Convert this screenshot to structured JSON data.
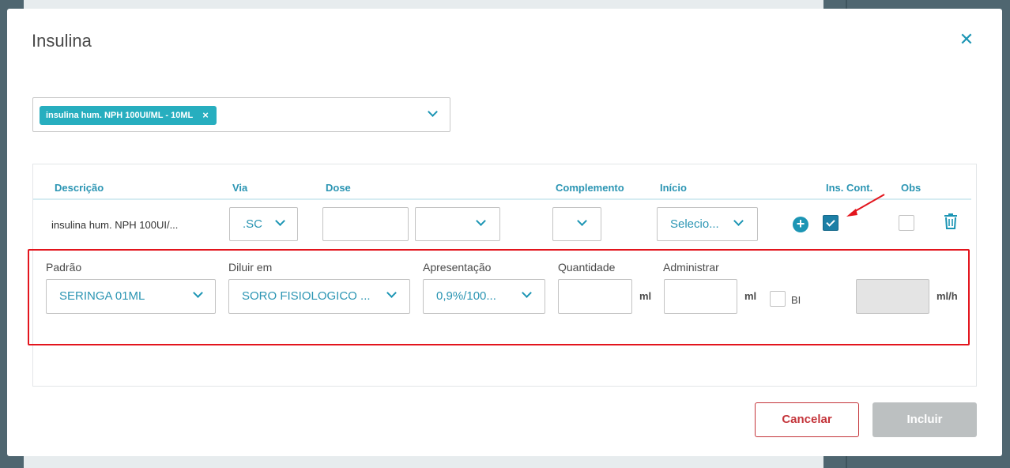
{
  "dialog": {
    "title": "Insulina",
    "close_icon": "close-icon"
  },
  "medication_select": {
    "chip_label": "insulina hum. NPH 100UI/ML - 10ML",
    "chip_remove": "×"
  },
  "table": {
    "headers": [
      "Descrição",
      "Via",
      "Dose",
      "Complemento",
      "Início",
      "Ins. Cont.",
      "Obs"
    ],
    "row": {
      "descricao": "insulina hum. NPH 100UI/...",
      "via": ".SC",
      "dose_value": "",
      "dose_unit": "",
      "complemento": "",
      "inicio": "Selecio...",
      "ins_cont_checked": true,
      "obs_checked": false
    }
  },
  "dilution": {
    "padrao_label": "Padrão",
    "padrao_value": "SERINGA 01ML",
    "diluir_label": "Diluir em",
    "diluir_value": "SORO FISIOLOGICO ...",
    "apresentacao_label": "Apresentação",
    "apresentacao_value": "0,9%/100...",
    "quantidade_label": "Quantidade",
    "quantidade_unit": "ml",
    "administrar_label": "Administrar",
    "administrar_unit": "ml",
    "bi_label": "BI",
    "rate_unit": "ml/h"
  },
  "footer": {
    "cancel_label": "Cancelar",
    "include_label": "Incluir"
  },
  "colors": {
    "accent": "#1c95b4",
    "chip": "#27aebf",
    "cancel": "#c4343a",
    "highlight": "#e3151d"
  }
}
